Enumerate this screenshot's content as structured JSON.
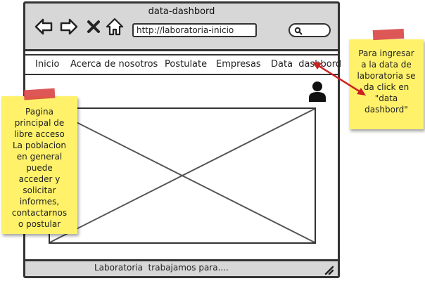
{
  "window": {
    "title": "data-dashbord"
  },
  "toolbar": {
    "icons": [
      "back-arrow-icon",
      "forward-arrow-icon",
      "close-icon",
      "home-icon",
      "search-icon"
    ],
    "url": "http://laboratoria-inicio"
  },
  "menu": {
    "items": [
      {
        "label": "Inicio"
      },
      {
        "label": "Acerca de nosotros"
      },
      {
        "label": "Postulate"
      },
      {
        "label": "Empresas"
      },
      {
        "label": "Data  dashbord"
      }
    ]
  },
  "footer": {
    "text": "Laboratoria  trabajamos para...."
  },
  "notes": {
    "left": {
      "lines": [
        "Pagina",
        "principal de",
        "libre acceso",
        "La poblacion",
        "en general",
        "puede",
        "acceder y",
        "solicitar",
        "informes,",
        "contactarnos",
        "o postular"
      ]
    },
    "right": {
      "lines": [
        "Para ingresar",
        "a la data de",
        "laboratoria se",
        "da click en",
        "\"data",
        "dashbord\""
      ]
    }
  },
  "colors": {
    "note": "#fff26a",
    "tape": "#d94545",
    "arrow": "#cc1f1f",
    "chrome": "#d7d7d7"
  }
}
